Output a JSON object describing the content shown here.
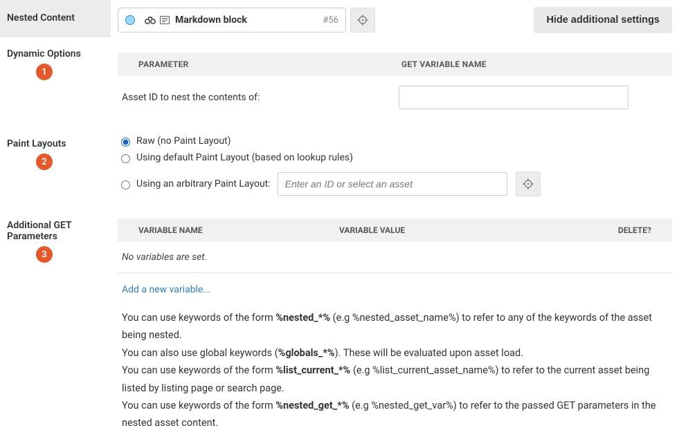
{
  "header": {
    "section_label": "Nested Content",
    "asset_name": "Markdown block",
    "asset_id": "#56",
    "hide_btn": "Hide additional settings"
  },
  "dynamic": {
    "section_label": "Dynamic Options",
    "badge": "1",
    "col_parameter": "PARAMETER",
    "col_get_var": "GET VARIABLE NAME",
    "asset_id_label": "Asset ID to nest the contents of:",
    "asset_id_value": ""
  },
  "paint": {
    "section_label": "Paint Layouts",
    "badge": "2",
    "opt_raw": "Raw (no Paint Layout)",
    "opt_default": "Using default Paint Layout (based on lookup rules)",
    "opt_arbitrary": "Using an arbitrary Paint Layout:",
    "arbitrary_placeholder": "Enter an ID or select an asset"
  },
  "getparams": {
    "section_label": "Additional GET Parameters",
    "badge": "3",
    "col_name": "VARIABLE NAME",
    "col_value": "VARIABLE VALUE",
    "col_delete": "DELETE?",
    "empty_msg": "No variables are set.",
    "add_link": "Add a new variable...",
    "help_nested_prefix": "You can use keywords of the form ",
    "help_nested_bold": "%nested_*%",
    "help_nested_suffix": " (e.g %nested_asset_name%) to refer to any of the keywords of the asset being nested.",
    "help_globals_prefix": "You can also use global keywords (",
    "help_globals_bold": "%globals_*%",
    "help_globals_suffix": "). These will be evaluated upon asset load.",
    "help_list_prefix": "You can use keywords of the form ",
    "help_list_bold": "%list_current_*%",
    "help_list_suffix": " (e.g %list_current_asset_name%) to refer to the current asset being listed by listing page or search page.",
    "help_get_prefix": "You can use keywords of the form ",
    "help_get_bold": "%nested_get_*%",
    "help_get_suffix": " (e.g %nested_get_var%) to refer to the passed GET parameters in the nested asset content."
  }
}
